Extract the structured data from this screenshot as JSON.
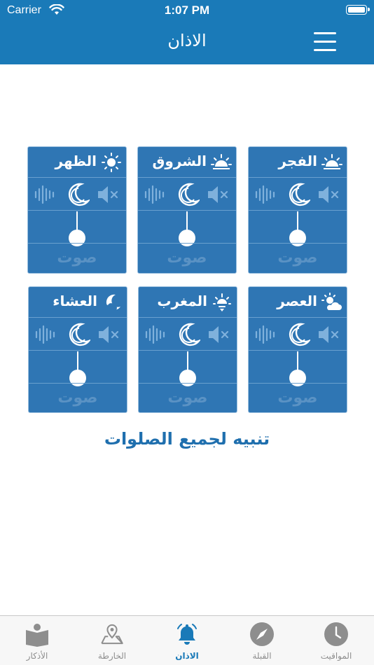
{
  "status": {
    "carrier": "Carrier",
    "time": "1:07 PM"
  },
  "header": {
    "title": "الاذان"
  },
  "prayers": [
    {
      "name": "الفجر",
      "icon": "sunrise-icon",
      "label": "صوت"
    },
    {
      "name": "الشروق",
      "icon": "sunrise-icon",
      "label": "صوت"
    },
    {
      "name": "الظهر",
      "icon": "sun-icon",
      "label": "صوت"
    },
    {
      "name": "العصر",
      "icon": "sun-cloud-icon",
      "label": "صوت"
    },
    {
      "name": "المغرب",
      "icon": "sunset-icon",
      "label": "صوت"
    },
    {
      "name": "العشاء",
      "icon": "moon-cloud-icon",
      "label": "صوت"
    }
  ],
  "alert_all": "تنبيه لجميع الصلوات",
  "tabs": [
    {
      "label": "المواقيت",
      "icon": "clock-icon"
    },
    {
      "label": "القبلة",
      "icon": "compass-icon"
    },
    {
      "label": "الاذان",
      "icon": "bell-icon",
      "active": true
    },
    {
      "label": "الخارطة",
      "icon": "map-icon"
    },
    {
      "label": "الأذكار",
      "icon": "book-icon"
    }
  ],
  "colors": {
    "primary": "#1a7ab8",
    "card": "#2f76b4",
    "active_tab": "#1a7ab8"
  }
}
